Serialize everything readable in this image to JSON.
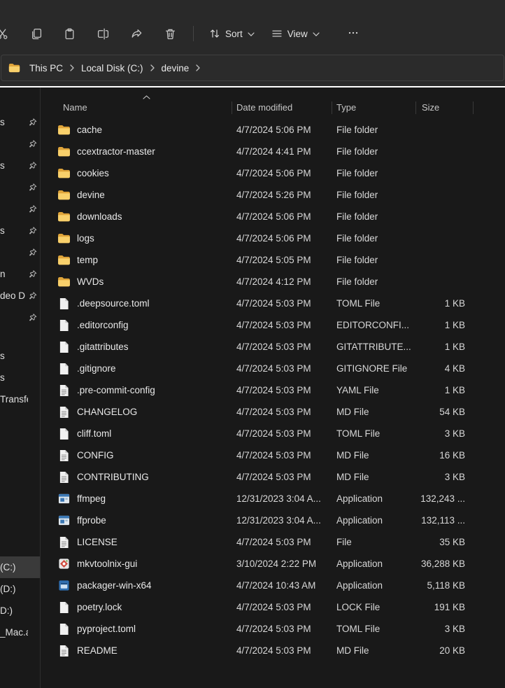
{
  "toolbar": {
    "buttons": [
      "cut",
      "copy",
      "paste",
      "rename",
      "share",
      "delete"
    ],
    "sort_label": "Sort",
    "view_label": "View",
    "more_icon": "more"
  },
  "breadcrumb": {
    "items": [
      "This PC",
      "Local Disk (C:)",
      "devine"
    ]
  },
  "columns": [
    "Name",
    "Date modified",
    "Type",
    "Size"
  ],
  "sort": {
    "column": "Name",
    "direction": "ascending"
  },
  "sidebar": {
    "sections": [
      {
        "items": [
          {
            "label": "s",
            "pin": true
          },
          {
            "label": "",
            "pin": true
          },
          {
            "label": "s",
            "pin": true
          },
          {
            "label": "",
            "pin": true
          },
          {
            "label": "",
            "pin": true
          },
          {
            "label": "s",
            "pin": true
          },
          {
            "label": "",
            "pin": true
          },
          {
            "label": "n",
            "pin": true
          },
          {
            "label": "deo D",
            "pin": true
          },
          {
            "label": "",
            "pin": true
          }
        ]
      },
      {
        "items": [
          {
            "label": "s",
            "pin": false
          },
          {
            "label": "s",
            "pin": false
          },
          {
            "label": "Transfer",
            "pin": false
          }
        ]
      },
      {
        "items": [
          {
            "label": "(C:)",
            "pin": false,
            "selected": true
          },
          {
            "label": "(D:)",
            "pin": false
          },
          {
            "label": "D:)",
            "pin": false
          },
          {
            "label": "_Mac.ap",
            "pin": false
          }
        ]
      }
    ]
  },
  "files": [
    {
      "name": "cache",
      "date": "4/7/2024 5:06 PM",
      "type": "File folder",
      "size": "",
      "icon": "folder"
    },
    {
      "name": "ccextractor-master",
      "date": "4/7/2024 4:41 PM",
      "type": "File folder",
      "size": "",
      "icon": "folder"
    },
    {
      "name": "cookies",
      "date": "4/7/2024 5:06 PM",
      "type": "File folder",
      "size": "",
      "icon": "folder"
    },
    {
      "name": "devine",
      "date": "4/7/2024 5:26 PM",
      "type": "File folder",
      "size": "",
      "icon": "folder"
    },
    {
      "name": "downloads",
      "date": "4/7/2024 5:06 PM",
      "type": "File folder",
      "size": "",
      "icon": "folder"
    },
    {
      "name": "logs",
      "date": "4/7/2024 5:06 PM",
      "type": "File folder",
      "size": "",
      "icon": "folder"
    },
    {
      "name": "temp",
      "date": "4/7/2024 5:05 PM",
      "type": "File folder",
      "size": "",
      "icon": "folder"
    },
    {
      "name": "WVDs",
      "date": "4/7/2024 4:12 PM",
      "type": "File folder",
      "size": "",
      "icon": "folder"
    },
    {
      "name": ".deepsource.toml",
      "date": "4/7/2024 5:03 PM",
      "type": "TOML File",
      "size": "1 KB",
      "icon": "file"
    },
    {
      "name": ".editorconfig",
      "date": "4/7/2024 5:03 PM",
      "type": "EDITORCONFI...",
      "size": "1 KB",
      "icon": "file"
    },
    {
      "name": ".gitattributes",
      "date": "4/7/2024 5:03 PM",
      "type": "GITATTRIBUTE...",
      "size": "1 KB",
      "icon": "file"
    },
    {
      "name": ".gitignore",
      "date": "4/7/2024 5:03 PM",
      "type": "GITIGNORE File",
      "size": "4 KB",
      "icon": "file"
    },
    {
      "name": ".pre-commit-config",
      "date": "4/7/2024 5:03 PM",
      "type": "YAML File",
      "size": "1 KB",
      "icon": "doc"
    },
    {
      "name": "CHANGELOG",
      "date": "4/7/2024 5:03 PM",
      "type": "MD File",
      "size": "54 KB",
      "icon": "doc"
    },
    {
      "name": "cliff.toml",
      "date": "4/7/2024 5:03 PM",
      "type": "TOML File",
      "size": "3 KB",
      "icon": "file"
    },
    {
      "name": "CONFIG",
      "date": "4/7/2024 5:03 PM",
      "type": "MD File",
      "size": "16 KB",
      "icon": "doc"
    },
    {
      "name": "CONTRIBUTING",
      "date": "4/7/2024 5:03 PM",
      "type": "MD File",
      "size": "3 KB",
      "icon": "doc"
    },
    {
      "name": "ffmpeg",
      "date": "12/31/2023 3:04 A...",
      "type": "Application",
      "size": "132,243 ...",
      "icon": "app-ffmpeg"
    },
    {
      "name": "ffprobe",
      "date": "12/31/2023 3:04 A...",
      "type": "Application",
      "size": "132,113 ...",
      "icon": "app-ffmpeg"
    },
    {
      "name": "LICENSE",
      "date": "4/7/2024 5:03 PM",
      "type": "File",
      "size": "35 KB",
      "icon": "doc"
    },
    {
      "name": "mkvtoolnix-gui",
      "date": "3/10/2024 2:22 PM",
      "type": "Application",
      "size": "36,288 KB",
      "icon": "app-mkv"
    },
    {
      "name": "packager-win-x64",
      "date": "4/7/2024 10:43 AM",
      "type": "Application",
      "size": "5,118 KB",
      "icon": "app-pkg"
    },
    {
      "name": "poetry.lock",
      "date": "4/7/2024 5:03 PM",
      "type": "LOCK File",
      "size": "191 KB",
      "icon": "file"
    },
    {
      "name": "pyproject.toml",
      "date": "4/7/2024 5:03 PM",
      "type": "TOML File",
      "size": "3 KB",
      "icon": "file"
    },
    {
      "name": "README",
      "date": "4/7/2024 5:03 PM",
      "type": "MD File",
      "size": "20 KB",
      "icon": "doc"
    }
  ],
  "colors": {
    "chrome_bg": "#292929",
    "content_bg": "#191919",
    "folder_yellow": "#f8d06b",
    "selection_gray": "#3a3a3a",
    "separator_white": "#ffffff"
  }
}
